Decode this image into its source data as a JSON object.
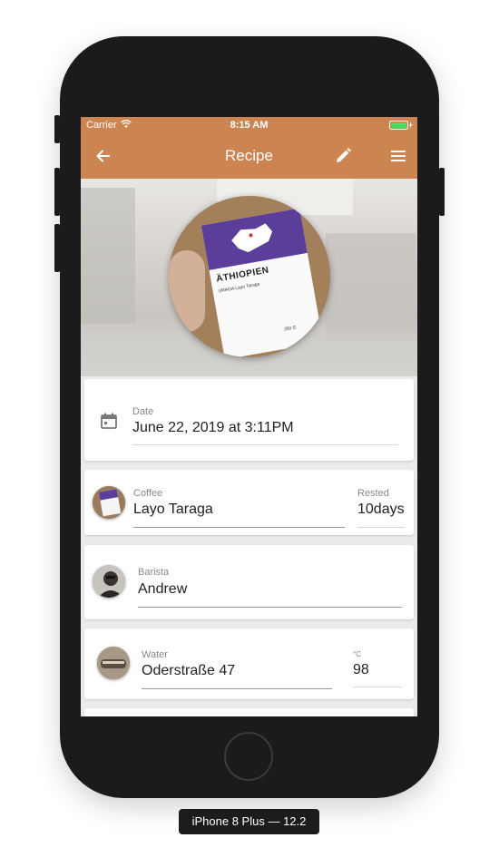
{
  "status_bar": {
    "carrier": "Carrier",
    "time": "8:15 AM"
  },
  "app_bar": {
    "title": "Recipe",
    "background_color": "#cc8550"
  },
  "hero": {
    "bag_brand": "ÄTHIOPIEN",
    "bag_details": "URAGA Layo Taraga",
    "bag_weight": "250 G"
  },
  "date_card": {
    "label": "Date",
    "value": "June 22, 2019 at 3:11PM"
  },
  "coffee_card": {
    "label": "Coffee",
    "value": "Layo Taraga",
    "rested_label": "Rested",
    "rested_value": "10days"
  },
  "barista_card": {
    "label": "Barista",
    "value": "Andrew"
  },
  "water_card": {
    "label": "Water",
    "value": "Oderstraße 47",
    "unit_label": "°C",
    "temperature": "98"
  },
  "device": {
    "label": "iPhone 8 Plus — 12.2"
  }
}
